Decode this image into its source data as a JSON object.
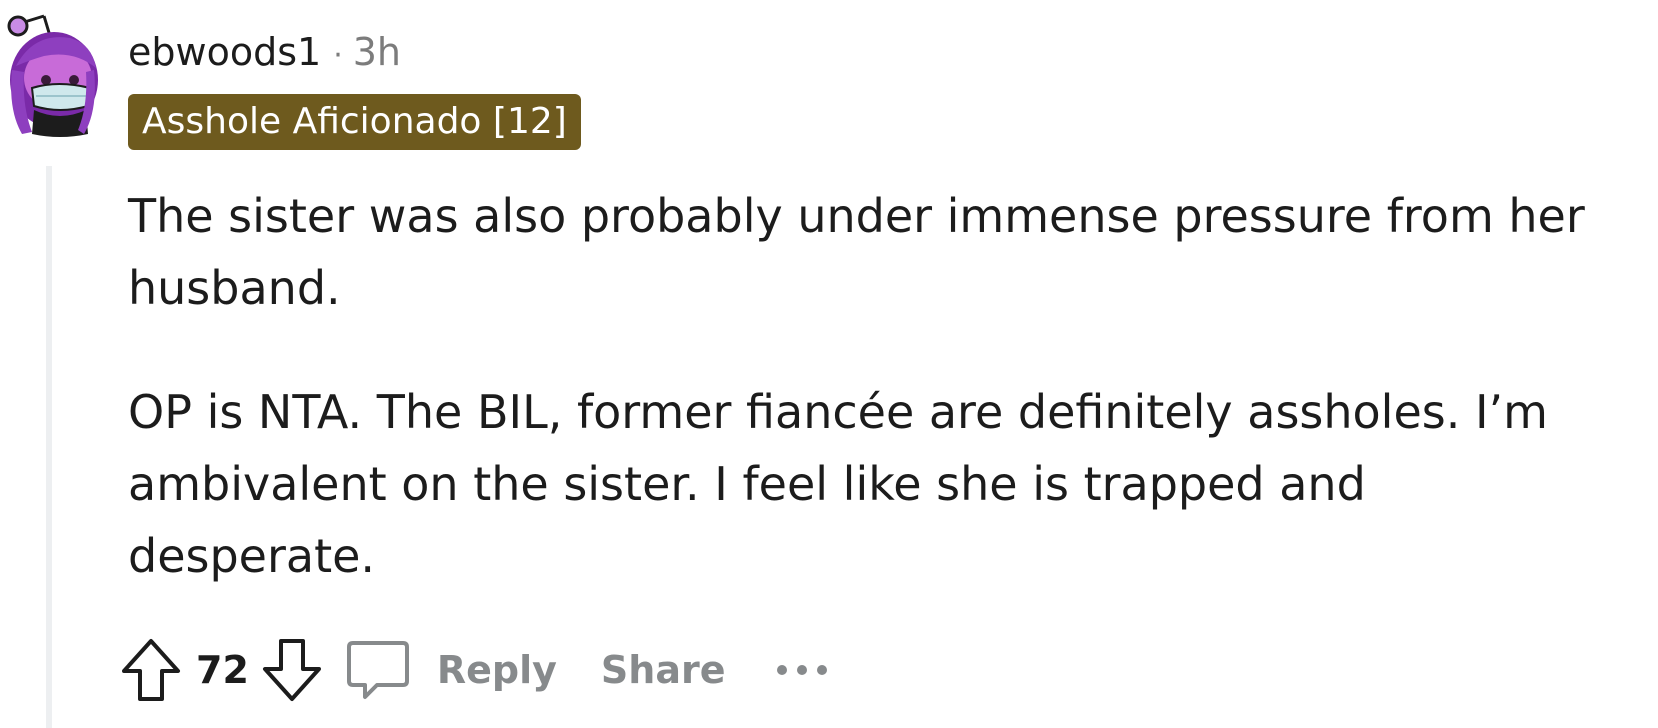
{
  "comment": {
    "author": "ebwoods1",
    "separator": "·",
    "time": "3h",
    "flair": "Asshole Aficionado [12]",
    "paragraphs": [
      "The sister was also probably under immense pressure from her husband.",
      "OP is NTA. The BIL, former fiancée are definitely assholes. I’m ambivalent on the sister. I feel like she is trapped and desperate."
    ],
    "score": "72",
    "reply_label": "Reply",
    "share_label": "Share"
  },
  "icons": {
    "avatar": "snoo-avatar",
    "upvote": "upvote-arrow-icon",
    "downvote": "downvote-arrow-icon",
    "reply": "comment-bubble-icon",
    "more": "more-dots-icon"
  },
  "colors": {
    "flair_bg": "#6e5a1e",
    "meta_text": "#7c7c7c",
    "action_text": "#878a8c",
    "thread_line": "#edeff1",
    "avatar_purple": "#8e3fbf"
  }
}
